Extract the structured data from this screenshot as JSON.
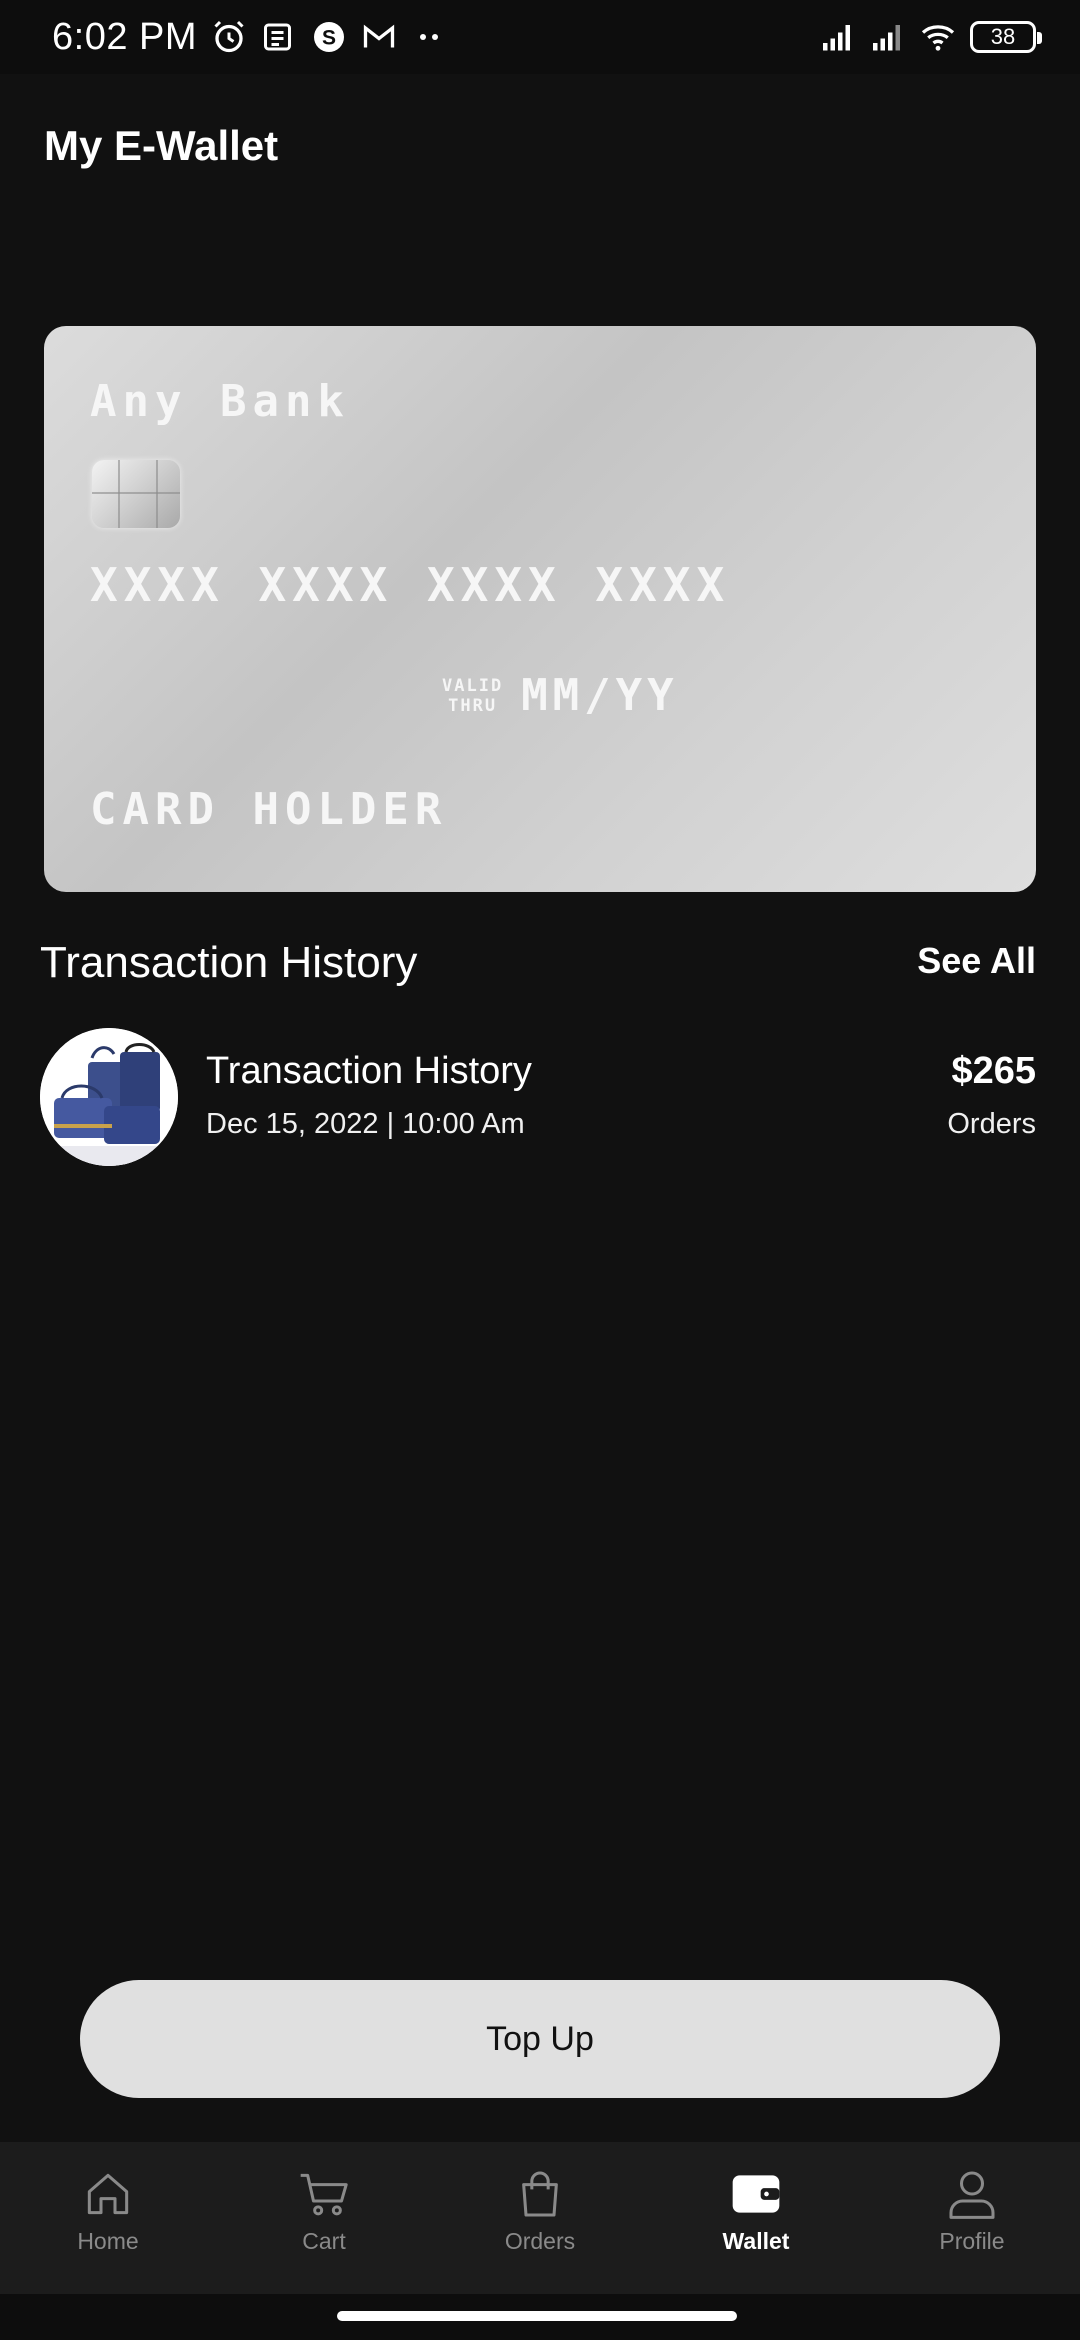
{
  "status_bar": {
    "time": "6:02 PM",
    "battery": "38",
    "icons": [
      "alarm-icon",
      "news-icon",
      "skype-icon",
      "gmail-icon",
      "more-dots-icon",
      "signal-icon",
      "signal-icon",
      "wifi-icon",
      "battery-icon"
    ]
  },
  "header": {
    "title": "My E-Wallet"
  },
  "card": {
    "bank": "Any Bank",
    "number": "XXXX XXXX XXXX XXXX",
    "valid_line1": "VALID",
    "valid_line2": "THRU",
    "expiry": "MM/YY",
    "holder": "CARD HOLDER"
  },
  "transactions": {
    "section_title": "Transaction History",
    "see_all": "See All",
    "items": [
      {
        "title": "Transaction History",
        "date": "Dec 15, 2022 | 10:00 Am",
        "amount": "$265",
        "type": "Orders"
      }
    ]
  },
  "topup": {
    "label": "Top Up"
  },
  "nav": {
    "items": [
      {
        "label": "Home",
        "icon": "home-icon",
        "active": false
      },
      {
        "label": "Cart",
        "icon": "cart-icon",
        "active": false
      },
      {
        "label": "Orders",
        "icon": "bag-icon",
        "active": false
      },
      {
        "label": "Wallet",
        "icon": "wallet-icon",
        "active": true
      },
      {
        "label": "Profile",
        "icon": "profile-icon",
        "active": false
      }
    ]
  },
  "colors": {
    "background": "#111111",
    "card": "#cccccc",
    "button": "#e0e0e0",
    "nav_background": "#1c1c1c",
    "nav_inactive": "#8a8a8a",
    "nav_active": "#ffffff"
  }
}
